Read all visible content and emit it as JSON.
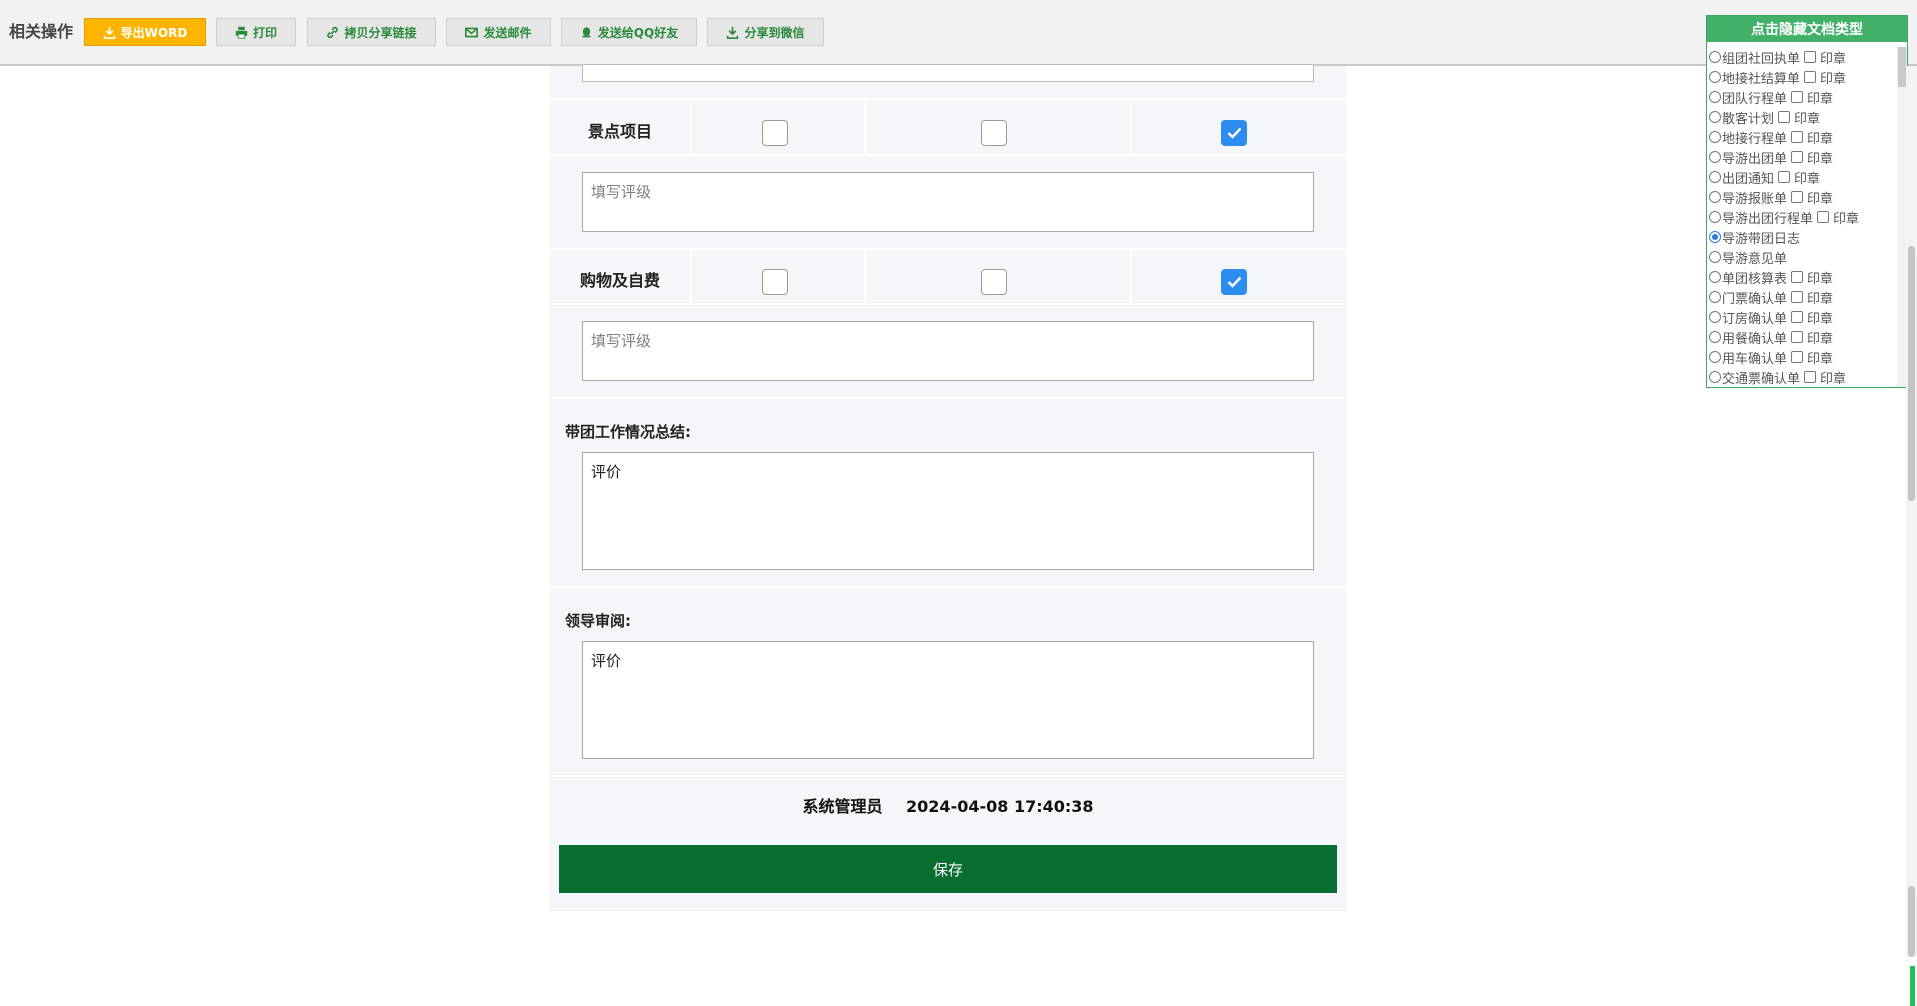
{
  "toolbar": {
    "title": "相关操作",
    "buttons": [
      {
        "label": "导出WORD",
        "icon": "download-icon"
      },
      {
        "label": "打印",
        "icon": "print-icon"
      },
      {
        "label": "拷贝分享链接",
        "icon": "link-icon"
      },
      {
        "label": "发送邮件",
        "icon": "mail-icon"
      },
      {
        "label": "发送给QQ好友",
        "icon": "qq-icon"
      },
      {
        "label": "分享到微信",
        "icon": "download-icon"
      }
    ]
  },
  "form": {
    "rows": [
      {
        "label": "景点项目",
        "checks": [
          false,
          false,
          true
        ],
        "rating_placeholder": "填写评级"
      },
      {
        "label": "购物及自费",
        "checks": [
          false,
          false,
          true
        ],
        "rating_placeholder": "填写评级"
      }
    ],
    "summary": {
      "label": "带团工作情况总结:",
      "value": "评价"
    },
    "review": {
      "label": "领导审阅:",
      "value": "评价"
    },
    "footer": {
      "user": "系统管理员",
      "datetime": "2024-04-08 17:40:38"
    },
    "save_label": "保存"
  },
  "doc_panel": {
    "header": "点击隐藏文档类型",
    "stamp_label": "印章",
    "items": [
      {
        "label": "组团社回执单",
        "stamp": true,
        "selected": false
      },
      {
        "label": "地接社结算单",
        "stamp": true,
        "selected": false
      },
      {
        "label": "团队行程单",
        "stamp": true,
        "selected": false
      },
      {
        "label": "散客计划",
        "stamp": true,
        "selected": false
      },
      {
        "label": "地接行程单",
        "stamp": true,
        "selected": false
      },
      {
        "label": "导游出团单",
        "stamp": true,
        "selected": false
      },
      {
        "label": "出团通知",
        "stamp": true,
        "selected": false
      },
      {
        "label": "导游报账单",
        "stamp": true,
        "selected": false
      },
      {
        "label": "导游出团行程单",
        "stamp": true,
        "selected": false
      },
      {
        "label": "导游带团日志",
        "stamp": false,
        "selected": true
      },
      {
        "label": "导游意见单",
        "stamp": false,
        "selected": false
      },
      {
        "label": "单团核算表",
        "stamp": true,
        "selected": false
      },
      {
        "label": "门票确认单",
        "stamp": true,
        "selected": false
      },
      {
        "label": "订房确认单",
        "stamp": true,
        "selected": false
      },
      {
        "label": "用餐确认单",
        "stamp": true,
        "selected": false
      },
      {
        "label": "用车确认单",
        "stamp": true,
        "selected": false
      },
      {
        "label": "交通票确认单",
        "stamp": true,
        "selected": false
      }
    ]
  },
  "colors": {
    "primary_button": "#ffb400",
    "save_button": "#0a6e32",
    "panel_header": "#43b06a",
    "checked": "#2d8cf0"
  }
}
